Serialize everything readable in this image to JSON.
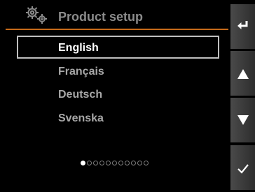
{
  "header": {
    "title": "Product setup",
    "icon": "gears-icon",
    "accent_color": "#c66a1a"
  },
  "languages": [
    {
      "label": "English",
      "selected": true
    },
    {
      "label": "Français",
      "selected": false
    },
    {
      "label": "Deutsch",
      "selected": false
    },
    {
      "label": "Svenska",
      "selected": false
    }
  ],
  "pagination": {
    "total": 11,
    "current": 1
  },
  "side_buttons": [
    {
      "icon": "back-arrow-icon"
    },
    {
      "icon": "arrow-up-icon"
    },
    {
      "icon": "arrow-down-icon"
    },
    {
      "icon": "checkmark-icon"
    }
  ]
}
